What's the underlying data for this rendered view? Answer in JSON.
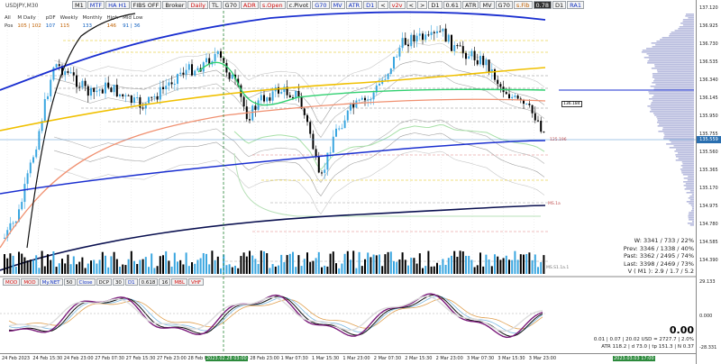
{
  "window": {
    "symbol": "USDJPY,M30"
  },
  "toolbar": {
    "buttons": [
      {
        "label": "M1",
        "style": "normal"
      },
      {
        "label": "MTF",
        "style": "blue"
      },
      {
        "label": "HA H1",
        "style": "blue"
      },
      {
        "label": "FIBS OFF",
        "style": "normal"
      },
      {
        "label": "Broker",
        "style": "normal"
      },
      {
        "label": "Daily",
        "style": "red"
      },
      {
        "label": "TL",
        "style": "normal"
      },
      {
        "label": "G70",
        "style": "normal"
      },
      {
        "label": "ADR",
        "style": "red"
      },
      {
        "label": "s.Open",
        "style": "red"
      },
      {
        "label": "c.Pivot",
        "style": "normal"
      },
      {
        "label": "G70",
        "style": "blue"
      },
      {
        "label": "MV",
        "style": "blue"
      },
      {
        "label": "ATR",
        "style": "blue"
      },
      {
        "label": "D1",
        "style": "blue"
      },
      {
        "label": "<",
        "style": "normal"
      },
      {
        "label": "v2v",
        "style": "red"
      },
      {
        "label": "<",
        "style": "normal"
      },
      {
        "label": ">",
        "style": "normal"
      },
      {
        "label": "D1",
        "style": "normal"
      },
      {
        "label": "0.61",
        "style": "normal"
      },
      {
        "label": "ATR",
        "style": "normal"
      },
      {
        "label": "MV",
        "style": "normal"
      },
      {
        "label": "G70",
        "style": "normal"
      },
      {
        "label": "s.Fib",
        "style": "orange"
      },
      {
        "label": "0.78",
        "style": "dark"
      },
      {
        "label": "D1",
        "style": "normal"
      },
      {
        "label": "RA1",
        "style": "blue"
      }
    ]
  },
  "mtf_table": {
    "header": [
      "All",
      "M Daily",
      "pDF",
      "Weekly",
      "Monthly",
      "High",
      "Mid Low"
    ],
    "rows": [
      [
        "Pos",
        "105 | 102",
        "107",
        "115",
        "133",
        "146",
        "91 | 36"
      ]
    ]
  },
  "price_axis": {
    "ticks": [
      "137.120",
      "136.925",
      "136.730",
      "136.535",
      "136.340",
      "136.145",
      "135.950",
      "135.755",
      "135.560",
      "135.365",
      "135.170",
      "134.975",
      "134.780",
      "134.585",
      "134.390"
    ],
    "current_price": "135.559",
    "indicator_ticks": [
      "29.133",
      "0.000",
      "-28.331"
    ]
  },
  "time_axis": {
    "ticks": [
      "24 Feb 2023",
      "24 Feb 15:30",
      "24 Feb 23:00",
      "27 Feb 07:30",
      "27 Feb 15:30",
      "27 Feb 23:00",
      "28 Feb 07:30",
      "28 Feb 15:30",
      "28 Feb 23:00",
      "1 Mar 07:30",
      "1 Mar 15:30",
      "1 Mar 23:00",
      "2 Mar 07:30",
      "2 Mar 15:30",
      "2 Mar 23:00",
      "3 Mar 07:30",
      "3 Mar 15:30",
      "3 Mar 23:00"
    ],
    "highlight": "2023.02.28 03:00",
    "highlight_right": "2023.03.03 17:00"
  },
  "stats": {
    "lines": [
      "W: 3341 / 733 / 22%",
      "Prev: 3346 / 1338 / 40%",
      "Past: 3362 / 2495 / 74%",
      "Last: 3398 / 2469 / 73%",
      "V ( M1 ): 2.9 / 1.7 / 5.2"
    ]
  },
  "indicator_panel": {
    "buttons": [
      {
        "label": "MOD",
        "style": "red"
      },
      {
        "label": "MOD",
        "style": "red"
      },
      {
        "label": "My.NET",
        "style": "blue"
      },
      {
        "label": "50",
        "style": "normal"
      },
      {
        "label": "Close",
        "style": "blue"
      },
      {
        "label": "DCP",
        "style": "normal"
      },
      {
        "label": "30",
        "style": "normal"
      },
      {
        "label": "D1",
        "style": "blue"
      },
      {
        "label": "0.618",
        "style": "normal"
      },
      {
        "label": "16",
        "style": "normal"
      },
      {
        "label": "MBL",
        "style": "red"
      },
      {
        "label": "VHF",
        "style": "red"
      }
    ],
    "big_value": "0.00",
    "info_line1": "0.01 | 0.07 | 20.02 USD = 2727.7 | 2.0%",
    "info_line2": "ATR 118.2 | d 73.0 | tp 151.3 | N 0.37"
  },
  "chart_labels": {
    "level_1": "125.196",
    "level_2": "MS.1a",
    "level_3": "MS.S1.1a.1"
  },
  "colors": {
    "candle_up": "#3aa6e0",
    "candle_down": "#000000",
    "ma_yellow": "#f0c000",
    "ma_blue": "#1a2fd0",
    "ma_navy": "#0a1050",
    "ma_green": "#30d070",
    "ma_salmon": "#f09070",
    "volume_up": "#3aa6e0",
    "volume_down": "#000000",
    "osc_white": "#ffffff",
    "osc_purple": "#7a1a7a",
    "osc_orange": "#e0a050"
  }
}
